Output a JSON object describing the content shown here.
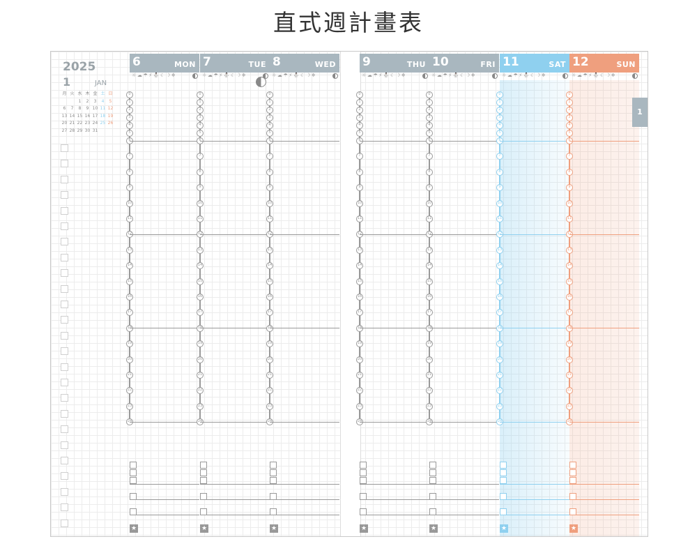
{
  "title": "直式週計畫表",
  "planner": {
    "year": "2025",
    "month_number": "1",
    "month_name": "JAN",
    "tab_label": "1",
    "mini_calendar": {
      "weekdays": [
        "月",
        "火",
        "水",
        "木",
        "金",
        "土",
        "日"
      ],
      "weeks": [
        [
          "",
          "",
          "1",
          "2",
          "3",
          "4",
          "5"
        ],
        [
          "6",
          "7",
          "8",
          "9",
          "10",
          "11",
          "12"
        ],
        [
          "13",
          "14",
          "15",
          "16",
          "17",
          "18",
          "19"
        ],
        [
          "20",
          "21",
          "22",
          "23",
          "24",
          "25",
          "26"
        ],
        [
          "27",
          "28",
          "29",
          "30",
          "31",
          "",
          ""
        ]
      ]
    },
    "weather_icons": "☼☁☂⚡⛄☾☽❄",
    "hours": [
      "0",
      "1",
      "2",
      "3",
      "4",
      "5",
      "6",
      "7",
      "8",
      "9",
      "10",
      "11",
      "12",
      "13",
      "14",
      "15",
      "16",
      "17",
      "18",
      "19",
      "20",
      "21",
      "22",
      "23",
      "24"
    ],
    "days": [
      {
        "num": "6",
        "name": "MON",
        "color": "#a9b7bf"
      },
      {
        "num": "7",
        "name": "TUE",
        "color": "#a9b7bf"
      },
      {
        "num": "8",
        "name": "WED",
        "color": "#a9b7bf"
      },
      {
        "num": "9",
        "name": "THU",
        "color": "#a9b7bf"
      },
      {
        "num": "10",
        "name": "FRI",
        "color": "#a9b7bf"
      },
      {
        "num": "11",
        "name": "SAT",
        "color": "#8fd0ef"
      },
      {
        "num": "12",
        "name": "SUN",
        "color": "#ef9f7e"
      }
    ],
    "colors": {
      "grey": "#a9b7bf",
      "sat": "#8fd0ef",
      "sun": "#ef9f7e",
      "line_grey": "#999999"
    }
  }
}
